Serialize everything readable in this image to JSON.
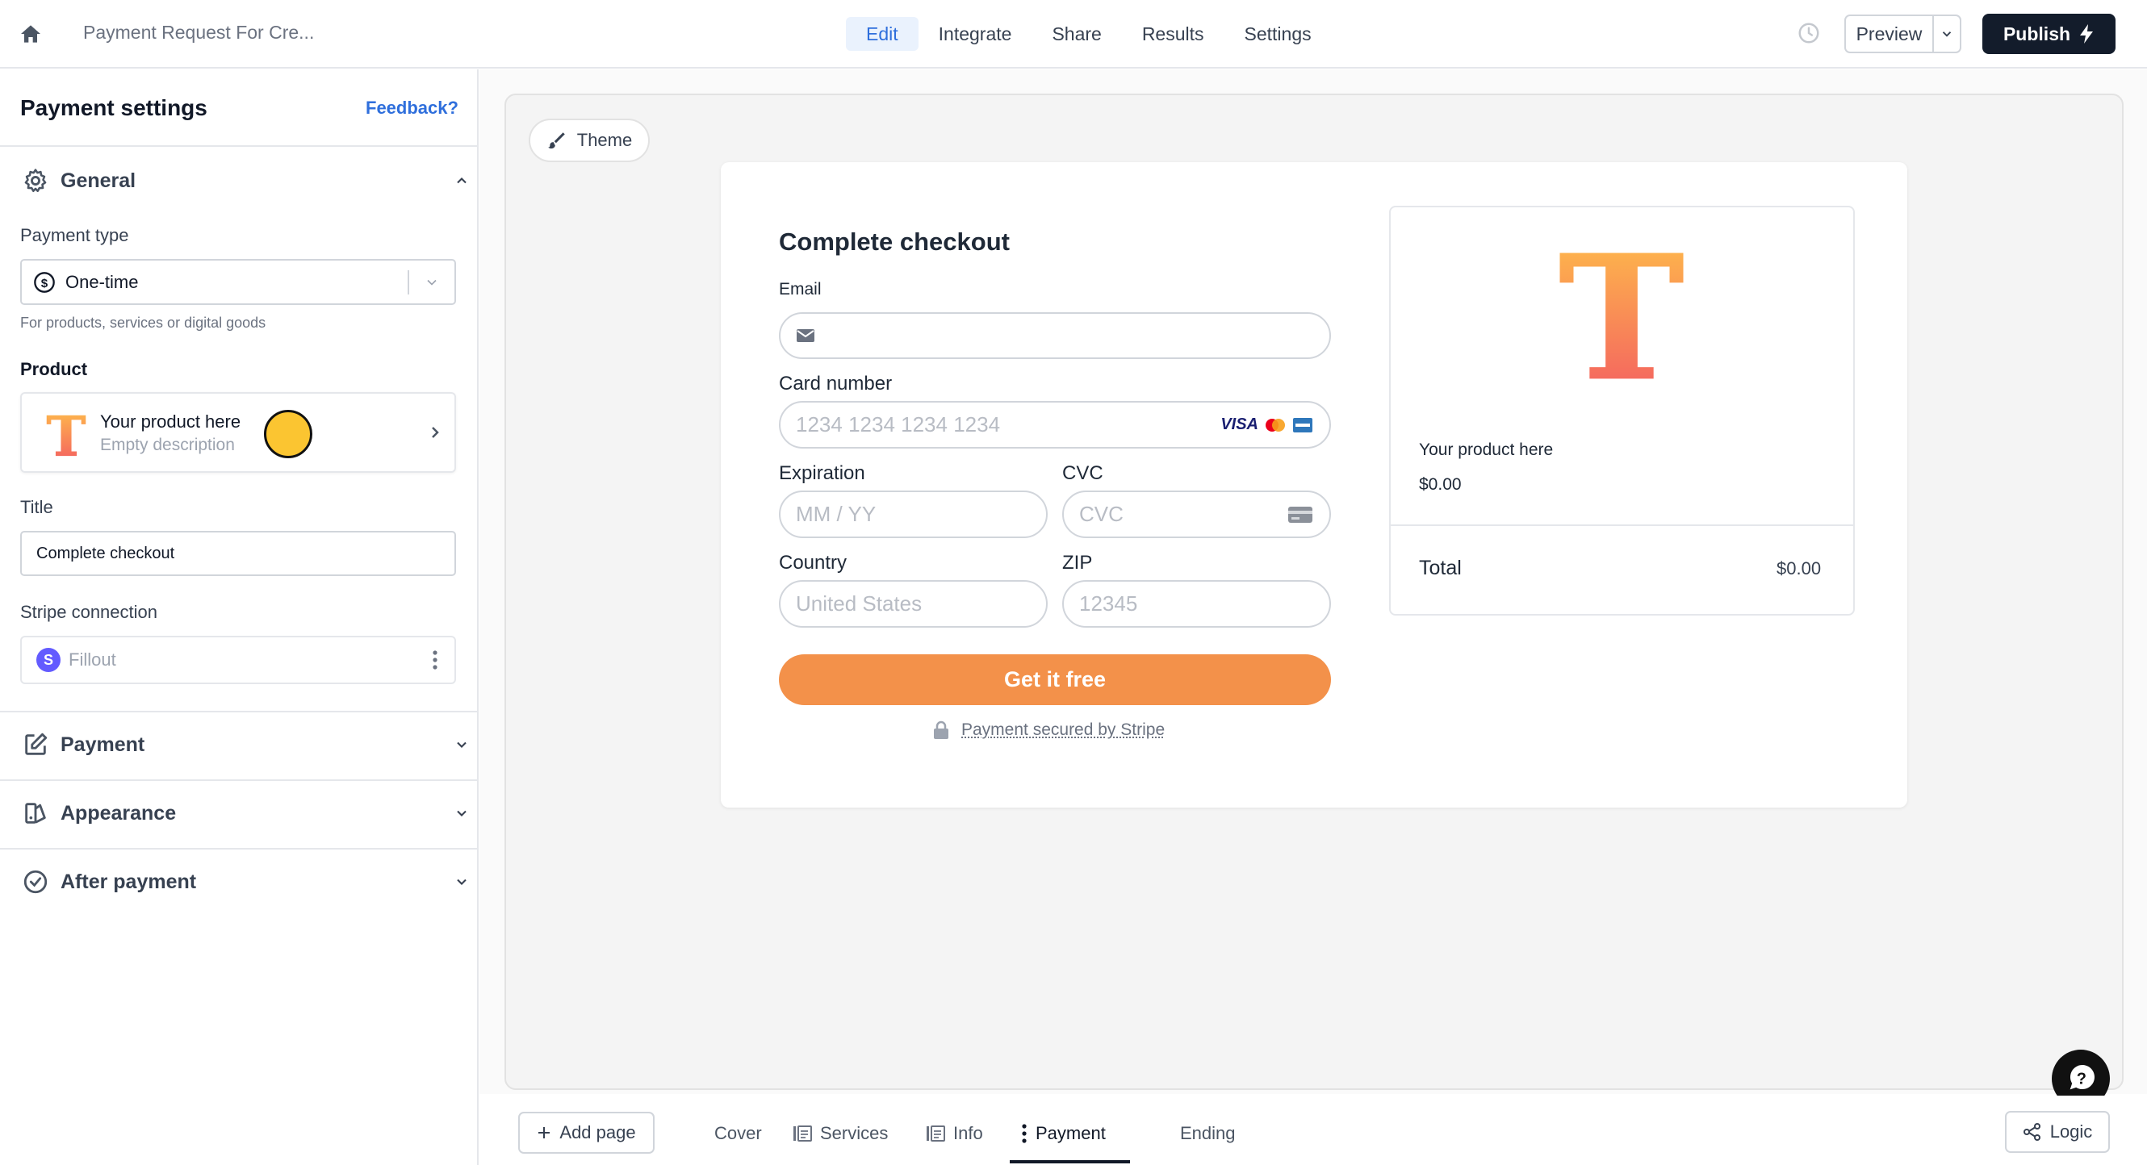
{
  "topbar": {
    "doc_title": "Payment Request For Cre...",
    "tabs": [
      {
        "label": "Edit",
        "active": true
      },
      {
        "label": "Integrate",
        "active": false
      },
      {
        "label": "Share",
        "active": false
      },
      {
        "label": "Results",
        "active": false
      },
      {
        "label": "Settings",
        "active": false
      }
    ],
    "preview_label": "Preview",
    "publish_label": "Publish"
  },
  "sidebar": {
    "header": "Payment settings",
    "feedback": "Feedback?",
    "general": {
      "title": "General",
      "payment_type_label": "Payment type",
      "payment_type_value": "One-time",
      "payment_type_hint": "For products, services or digital goods",
      "product_label": "Product",
      "product_name": "Your product here",
      "product_desc": "Empty description",
      "title_label": "Title",
      "title_value": "Complete checkout",
      "stripe_label": "Stripe connection",
      "stripe_account": "Fillout"
    },
    "sections": [
      {
        "title": "Payment",
        "icon": "edit-icon"
      },
      {
        "title": "Appearance",
        "icon": "appearance-icon"
      },
      {
        "title": "After payment",
        "icon": "check-circle-icon"
      }
    ]
  },
  "canvas": {
    "theme_label": "Theme",
    "checkout": {
      "title": "Complete checkout",
      "email_label": "Email",
      "card_label": "Card number",
      "card_placeholder": "1234 1234 1234 1234",
      "card_brand_visa": "VISA",
      "expiration_label": "Expiration",
      "expiration_placeholder": "MM / YY",
      "cvc_label": "CVC",
      "cvc_placeholder": "CVC",
      "country_label": "Country",
      "country_placeholder": "United States",
      "zip_label": "ZIP",
      "zip_placeholder": "12345",
      "cta": "Get it free",
      "secured": "Payment secured by Stripe"
    },
    "summary": {
      "product_name": "Your product here",
      "price": "$0.00",
      "total_label": "Total",
      "total_value": "$0.00"
    }
  },
  "pagebar": {
    "add_page": "Add page",
    "pages": [
      {
        "label": "Cover",
        "icon": "",
        "active": false
      },
      {
        "label": "Services",
        "icon": "form-page-icon",
        "active": false
      },
      {
        "label": "Info",
        "icon": "form-page-icon",
        "active": false
      },
      {
        "label": "Payment",
        "icon": "kebab-icon",
        "active": true
      },
      {
        "label": "Ending",
        "icon": "",
        "active": false
      }
    ],
    "logic": "Logic"
  },
  "colors": {
    "accent": "#2f6fdc",
    "cta": "#f3914a",
    "publish": "#131c2b",
    "stripe": "#635bff"
  }
}
